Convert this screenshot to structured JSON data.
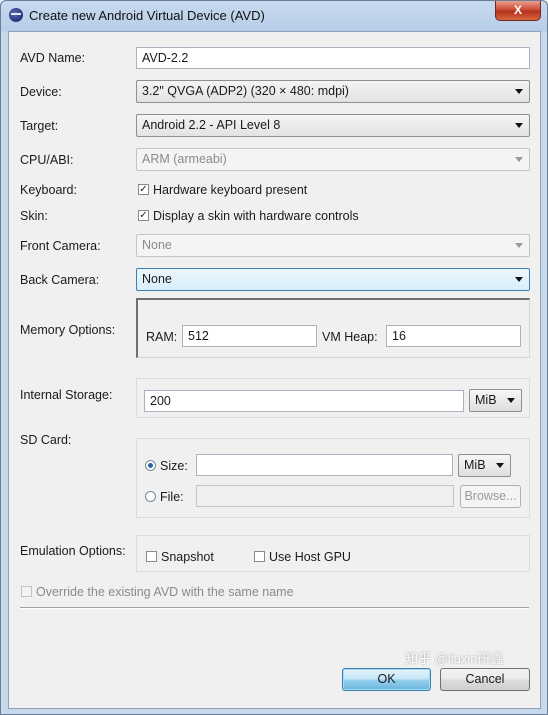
{
  "window": {
    "title": "Create new Android Virtual Device (AVD)",
    "close_glyph": "X"
  },
  "form": {
    "avd_name": {
      "label": "AVD Name:",
      "value": "AVD-2.2"
    },
    "device": {
      "label": "Device:",
      "value": "3.2\" QVGA (ADP2) (320 × 480: mdpi)"
    },
    "target": {
      "label": "Target:",
      "value": "Android 2.2 - API Level 8"
    },
    "cpu_abi": {
      "label": "CPU/ABI:",
      "value": "ARM (armeabi)"
    },
    "keyboard": {
      "label": "Keyboard:",
      "checkbox_label": "Hardware keyboard present",
      "checked": true
    },
    "skin": {
      "label": "Skin:",
      "checkbox_label": "Display a skin with hardware controls",
      "checked": true
    },
    "front_camera": {
      "label": "Front Camera:",
      "value": "None"
    },
    "back_camera": {
      "label": "Back Camera:",
      "value": "None"
    },
    "memory": {
      "label": "Memory Options:",
      "ram_label": "RAM:",
      "ram_value": "512",
      "vm_heap_label": "VM Heap:",
      "vm_heap_value": "16"
    },
    "internal_storage": {
      "label": "Internal Storage:",
      "value": "200",
      "unit": "MiB"
    },
    "sd_card": {
      "label": "SD Card:",
      "size_label": "Size:",
      "size_value": "",
      "size_unit": "MiB",
      "file_label": "File:",
      "file_value": "",
      "browse_label": "Browse...",
      "selected": "size"
    },
    "emulation": {
      "label": "Emulation Options:",
      "snapshot_label": "Snapshot",
      "snapshot_checked": false,
      "host_gpu_label": "Use Host GPU",
      "host_gpu_checked": false
    },
    "override": {
      "label": "Override the existing AVD with the same name",
      "checked": false
    }
  },
  "buttons": {
    "ok": "OK",
    "cancel": "Cancel"
  },
  "watermark": "知乎 @liuxin研鑫",
  "colors": {
    "title_bar": "#b7cde7",
    "close_button": "#c9432d",
    "focus_border": "#3c7fb1"
  }
}
